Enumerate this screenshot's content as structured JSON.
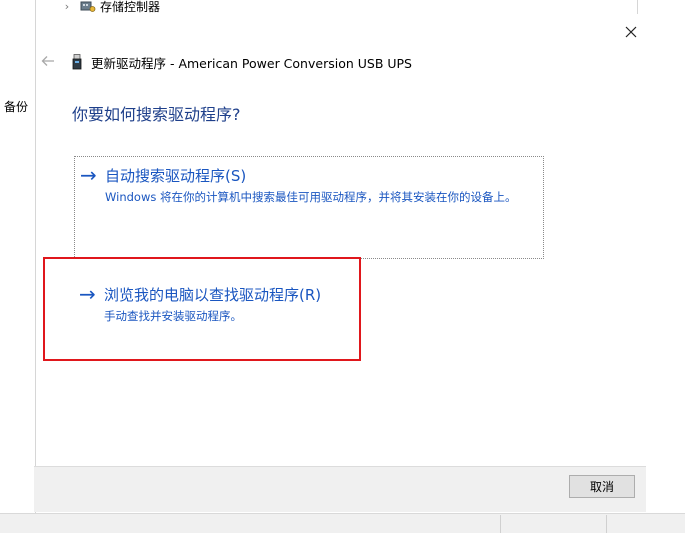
{
  "background": {
    "tree_item_label": "存储控制器",
    "side_label": "备份"
  },
  "dialog": {
    "title": "更新驱动程序 - American Power Conversion USB UPS",
    "question": "你要如何搜索驱动程序?",
    "options": [
      {
        "title": "自动搜索驱动程序(S)",
        "description": "Windows 将在你的计算机中搜索最佳可用驱动程序，并将其安装在你的设备上。"
      },
      {
        "title": "浏览我的电脑以查找驱动程序(R)",
        "description": "手动查找并安装驱动程序。"
      }
    ],
    "cancel_label": "取消"
  },
  "icons": {
    "close": "close-icon",
    "back": "back-arrow-icon",
    "device": "usb-device-icon",
    "option_arrow": "right-arrow-icon",
    "controller": "storage-controller-icon",
    "chevron": "chevron-right-icon"
  },
  "colors": {
    "link_blue": "#1a56c0",
    "heading_blue": "#1e3f8a",
    "highlight_red": "#e0171c",
    "footer_bg": "#f0f0f0"
  }
}
